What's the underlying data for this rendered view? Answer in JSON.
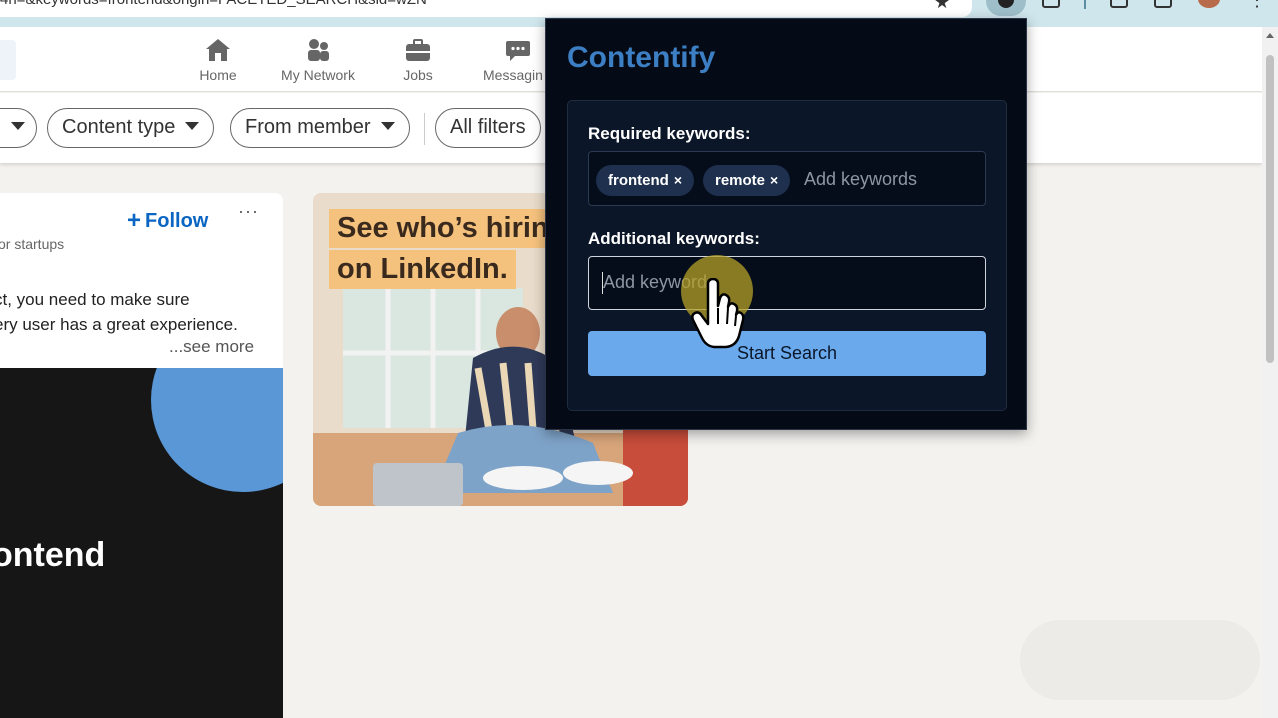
{
  "browser": {
    "url_text": "4n=&keywords=frontend&origin=FACETED_SEARCH&sid=wZN"
  },
  "nav": {
    "items": [
      {
        "label": "Home",
        "icon": "home-icon"
      },
      {
        "label": "My Network",
        "icon": "network-icon"
      },
      {
        "label": "Jobs",
        "icon": "briefcase-icon"
      },
      {
        "label": "Messagin",
        "icon": "messaging-icon"
      }
    ]
  },
  "filters": {
    "content_type": "Content type",
    "from_member": "From member",
    "all_filters": "All filters"
  },
  "post": {
    "follow_label": "Follow",
    "more_label": "···",
    "subtitle": "or startups",
    "text_line1": "ct, you need to make sure",
    "text_line2": "ery user has a great experience.",
    "see_more": "...see more",
    "image_title": "ontend"
  },
  "ad": {
    "line1": "See who’s hiring",
    "line2": "on LinkedIn."
  },
  "extension": {
    "title": "Contentify",
    "required_label": "Required keywords:",
    "required_chips": [
      "frontend",
      "remote"
    ],
    "chip_remove": "×",
    "required_placeholder": "Add keywords",
    "additional_label": "Additional keywords:",
    "additional_placeholder": "Add keywords",
    "start_button": "Start Search"
  },
  "colors": {
    "linkedin_blue": "#0a66c2",
    "popup_bg": "#040b16",
    "brand_title": "#3d7fc4",
    "start_button": "#6aa9ec"
  }
}
